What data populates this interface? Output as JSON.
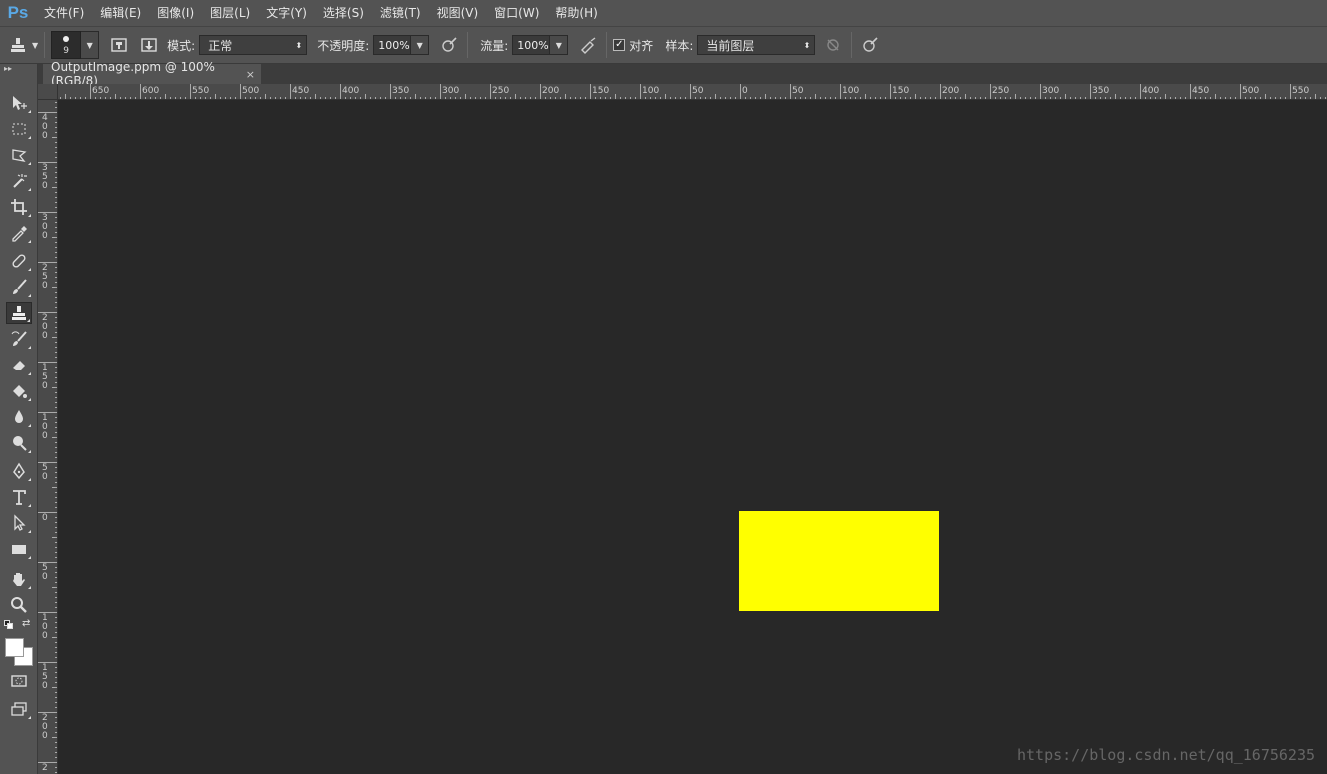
{
  "app": {
    "logo": "Ps"
  },
  "menu": [
    "文件(F)",
    "编辑(E)",
    "图像(I)",
    "图层(L)",
    "文字(Y)",
    "选择(S)",
    "滤镜(T)",
    "视图(V)",
    "窗口(W)",
    "帮助(H)"
  ],
  "options": {
    "brush_size": "9",
    "mode_label": "模式:",
    "mode_value": "正常",
    "opacity_label": "不透明度:",
    "opacity_value": "100%",
    "flow_label": "流量:",
    "flow_value": "100%",
    "aligned_label": "对齐",
    "aligned_checked": true,
    "sample_label": "样本:",
    "sample_value": "当前图层"
  },
  "document": {
    "tab_title": "OutputImage.ppm @ 100%(RGB/8)",
    "close_glyph": "×",
    "image_color": "#ffff00"
  },
  "rulers": {
    "horizontal_labels": [
      "650",
      "600",
      "550",
      "500",
      "450",
      "400",
      "350",
      "300",
      "250",
      "200",
      "150",
      "100",
      "50",
      "0",
      "50",
      "100",
      "150",
      "200",
      "250",
      "300",
      "350",
      "400",
      "450",
      "500",
      "550"
    ],
    "vertical_labels": [
      "400",
      "350",
      "300",
      "250",
      "200",
      "150",
      "100",
      "50",
      "0",
      "50",
      "100",
      "150",
      "200",
      "2"
    ]
  },
  "tools": [
    "move-icon",
    "marquee-icon",
    "lasso-icon",
    "magic-wand-icon",
    "crop-icon",
    "eyedropper-icon",
    "healing-brush-icon",
    "brush-icon",
    "clone-stamp-icon",
    "history-brush-icon",
    "eraser-icon",
    "paint-bucket-icon",
    "blur-icon",
    "dodge-icon",
    "pen-icon",
    "type-icon",
    "path-selection-icon",
    "rectangle-icon",
    "hand-icon",
    "zoom-icon"
  ],
  "watermark": "https://blog.csdn.net/qq_16756235",
  "colors": {
    "accent": "#5aa9e6",
    "foreground": "#ffffff",
    "background": "#ffffff"
  }
}
